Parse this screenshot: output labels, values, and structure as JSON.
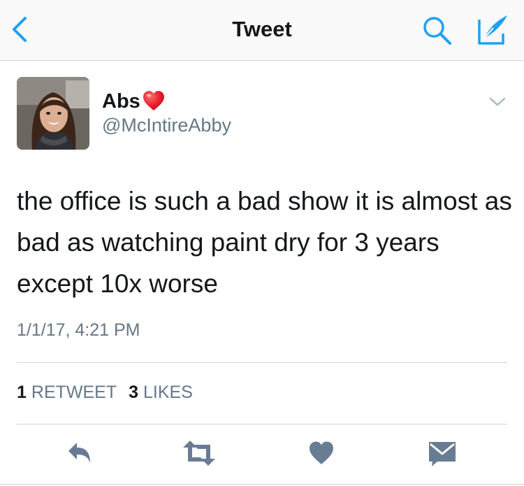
{
  "nav": {
    "title": "Tweet",
    "back_icon": "chevron-left-icon",
    "search_icon": "search-icon",
    "compose_icon": "compose-tweet-icon"
  },
  "author": {
    "display_name": "Abs",
    "name_emoji": "red-heart-emoji",
    "handle": "@McIntireAbby"
  },
  "tweet": {
    "text": "the office is such a bad show it is almost as bad as watching paint dry for 3 years except 10x worse",
    "timestamp": "1/1/17, 4:21 PM"
  },
  "stats": {
    "retweets_count": "1",
    "retweets_label": "RETWEET",
    "likes_count": "3",
    "likes_label": "LIKES"
  },
  "actions": [
    "reply-icon",
    "retweet-icon",
    "like-icon",
    "direct-message-icon"
  ],
  "colors": {
    "twitter_blue": "#1da1f2",
    "text_primary": "#14171a",
    "text_secondary": "#657786",
    "action_gray": "#687c93",
    "divider": "#cfd4d8",
    "heart_red": "#e0245e"
  }
}
